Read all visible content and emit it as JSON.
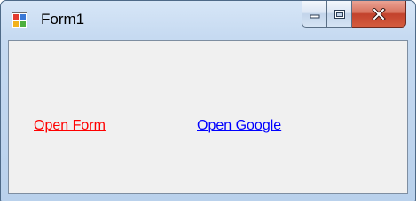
{
  "window": {
    "title": "Form1",
    "accent_color": "#b9d1ec",
    "client_background": "#f0f0f0"
  },
  "title_bar_buttons": [
    {
      "name": "minimize",
      "icon": "minimize-icon"
    },
    {
      "name": "maximize",
      "icon": "maximize-icon"
    },
    {
      "name": "close",
      "icon": "close-icon"
    }
  ],
  "links": {
    "open_form": {
      "label": "Open Form",
      "color": "#ff0000"
    },
    "open_google": {
      "label": "Open Google",
      "color": "#0000ff"
    }
  }
}
